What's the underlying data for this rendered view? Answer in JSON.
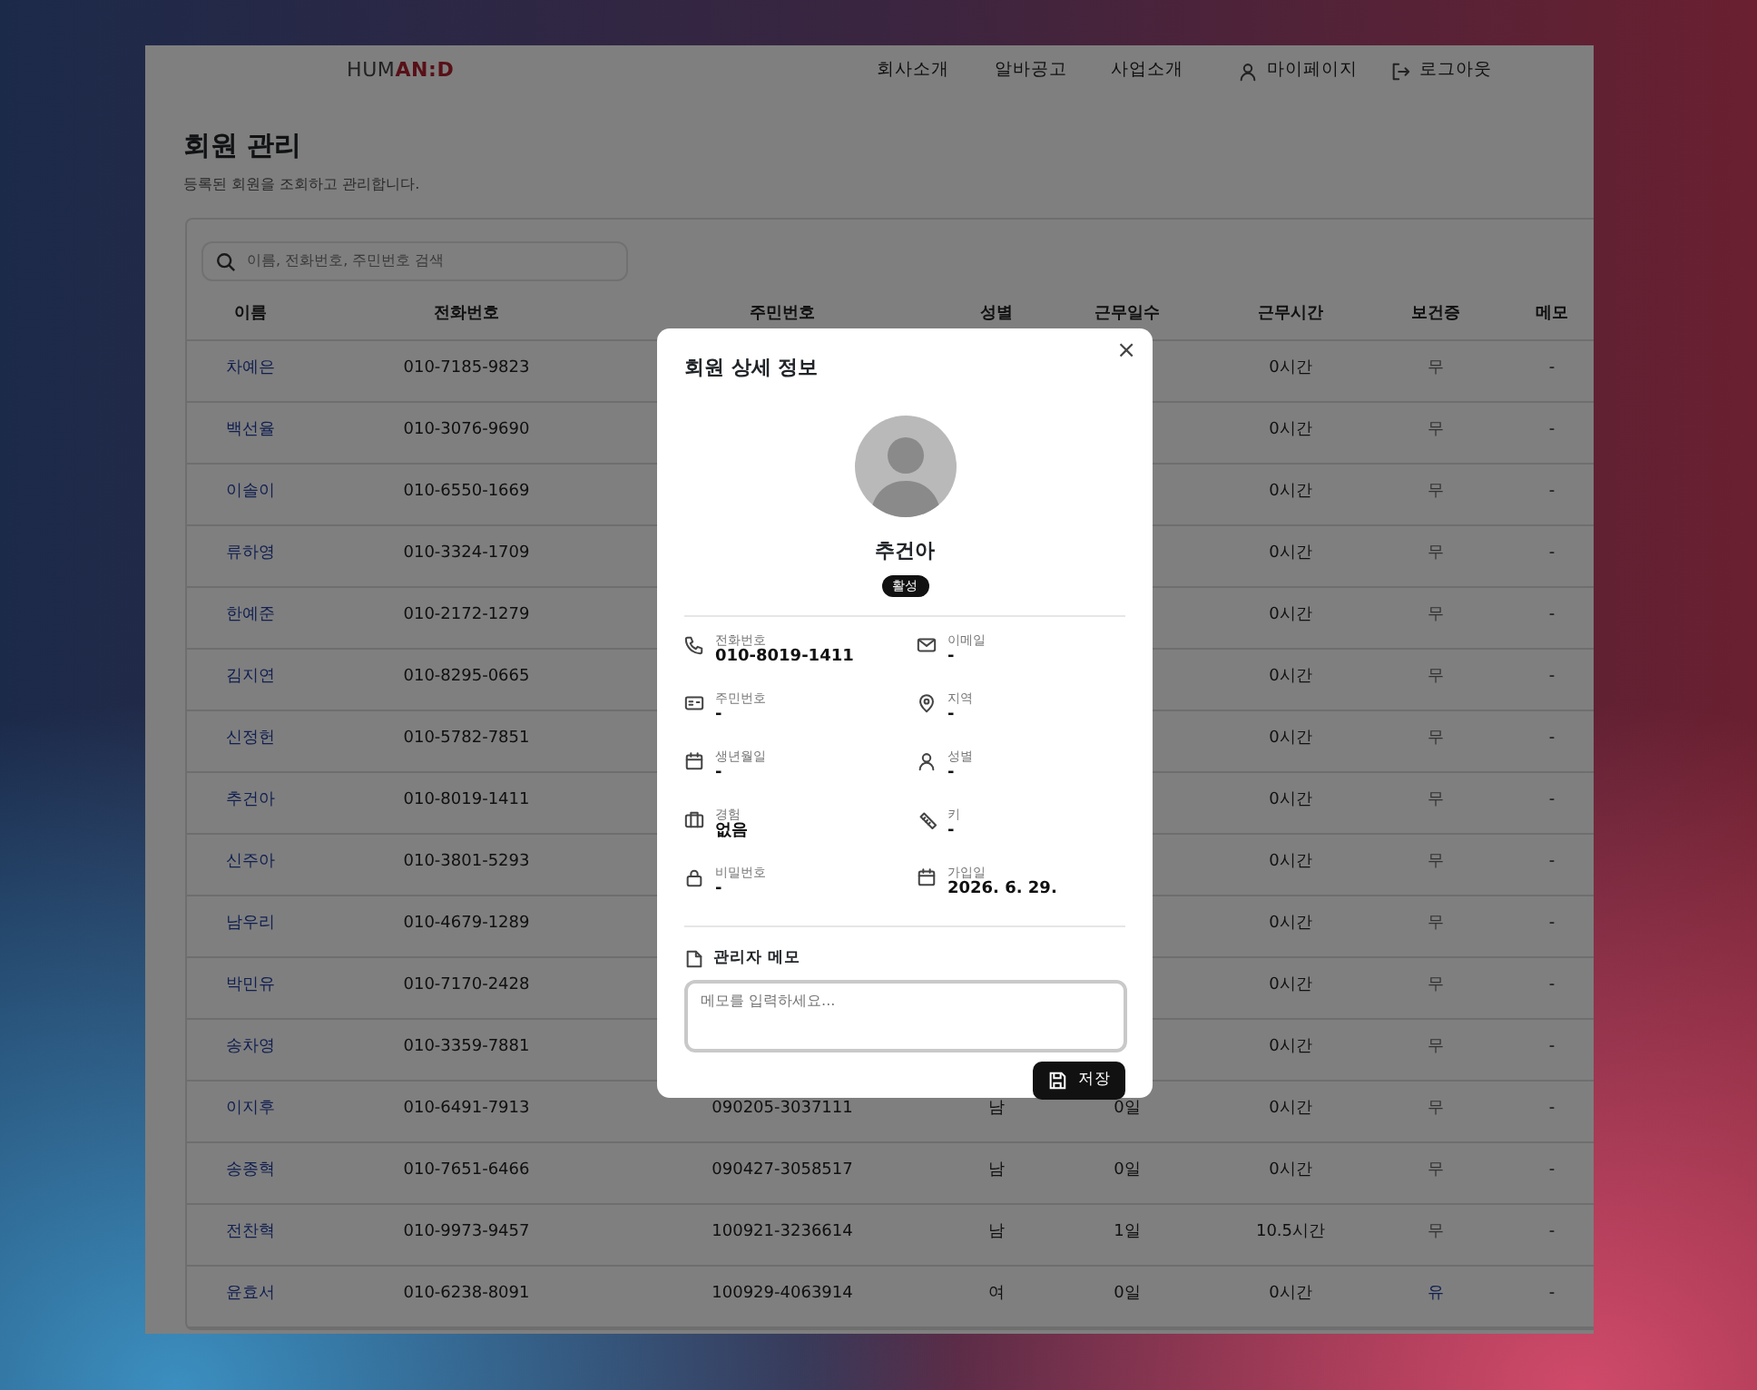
{
  "navbar": {
    "logo": [
      {
        "text": "HUM",
        "accent": false
      },
      {
        "text": "AN:D",
        "accent": true
      }
    ],
    "links": [
      {
        "label": "회사소개",
        "kind": "text"
      },
      {
        "label": "알바공고",
        "kind": "text"
      },
      {
        "label": "사업소개",
        "kind": "text"
      },
      {
        "label": "마이페이지",
        "kind": "user"
      },
      {
        "label": "로그아웃",
        "kind": "logout"
      }
    ]
  },
  "page": {
    "title": "회원 관리",
    "subtitle": "등록된 회원을 조회하고 관리합니다."
  },
  "search": {
    "placeholder": "이름, 전화번호, 주민번호 검색"
  },
  "table": {
    "columns": [
      "이름",
      "전화번호",
      "주민번호",
      "성별",
      "근무일수",
      "근무시간",
      "보건증",
      "메모"
    ],
    "rows": [
      {
        "name": "차예은",
        "phone": "010-7185-9823",
        "hours": "0시간",
        "health": "무",
        "health_yes": false,
        "memo": "-"
      },
      {
        "name": "백선율",
        "phone": "010-3076-9690",
        "hours": "0시간",
        "health": "무",
        "health_yes": false,
        "memo": "-"
      },
      {
        "name": "이솔이",
        "phone": "010-6550-1669",
        "hours": "0시간",
        "health": "무",
        "health_yes": false,
        "memo": "-"
      },
      {
        "name": "류하영",
        "phone": "010-3324-1709",
        "hours": "0시간",
        "health": "무",
        "health_yes": false,
        "memo": "-"
      },
      {
        "name": "한예준",
        "phone": "010-2172-1279",
        "hours": "0시간",
        "health": "무",
        "health_yes": false,
        "memo": "-"
      },
      {
        "name": "김지연",
        "phone": "010-8295-0665",
        "hours": "0시간",
        "health": "무",
        "health_yes": false,
        "memo": "-"
      },
      {
        "name": "신정헌",
        "phone": "010-5782-7851",
        "hours": "0시간",
        "health": "무",
        "health_yes": false,
        "memo": "-"
      },
      {
        "name": "추건아",
        "phone": "010-8019-1411",
        "hours": "0시간",
        "health": "무",
        "health_yes": false,
        "memo": "-"
      },
      {
        "name": "신주아",
        "phone": "010-3801-5293",
        "hours": "0시간",
        "health": "무",
        "health_yes": false,
        "memo": "-"
      },
      {
        "name": "남우리",
        "phone": "010-4679-1289",
        "hours": "0시간",
        "health": "무",
        "health_yes": false,
        "memo": "-"
      },
      {
        "name": "박민유",
        "phone": "010-7170-2428",
        "hours": "0시간",
        "health": "무",
        "health_yes": false,
        "memo": "-"
      },
      {
        "name": "송차영",
        "phone": "010-3359-7881",
        "hours": "0시간",
        "health": "무",
        "health_yes": false,
        "memo": "-"
      },
      {
        "name": "이지후",
        "phone": "010-6491-7913",
        "rrn": "090205-3037111",
        "gender": "남",
        "days": "0일",
        "hours": "0시간",
        "health": "무",
        "health_yes": false,
        "memo": "-"
      },
      {
        "name": "송종혁",
        "phone": "010-7651-6466",
        "rrn": "090427-3058517",
        "gender": "남",
        "days": "0일",
        "hours": "0시간",
        "health": "무",
        "health_yes": false,
        "memo": "-"
      },
      {
        "name": "전찬혁",
        "phone": "010-9973-9457",
        "rrn": "100921-3236614",
        "gender": "남",
        "days": "1일",
        "hours": "10.5시간",
        "health": "무",
        "health_yes": false,
        "memo": "-"
      },
      {
        "name": "윤효서",
        "phone": "010-6238-8091",
        "rrn": "100929-4063914",
        "gender": "여",
        "days": "0일",
        "hours": "0시간",
        "health": "유",
        "health_yes": true,
        "memo": "-"
      }
    ]
  },
  "modal": {
    "title": "회원 상세 정보",
    "close": "×",
    "name": "추건아",
    "status": "활성",
    "fields": [
      {
        "kind": "phone",
        "label": "전화번호",
        "value": "010-8019-1411"
      },
      {
        "kind": "mail",
        "label": "이메일",
        "value": "-"
      },
      {
        "kind": "idcard",
        "label": "주민번호",
        "value": "-"
      },
      {
        "kind": "pin",
        "label": "지역",
        "value": "-"
      },
      {
        "kind": "calendar",
        "label": "생년월일",
        "value": "-"
      },
      {
        "kind": "user",
        "label": "성별",
        "value": "-"
      },
      {
        "kind": "briefcase",
        "label": "경험",
        "value": "없음"
      },
      {
        "kind": "ruler",
        "label": "키",
        "value": "-"
      },
      {
        "kind": "lock",
        "label": "비밀번호",
        "value": "-"
      },
      {
        "kind": "calendar",
        "label": "가입일",
        "value": "2026. 6. 29."
      }
    ],
    "memo": {
      "title": "관리자 메모",
      "placeholder": "메모를 입력하세요..."
    },
    "save": "저장"
  }
}
